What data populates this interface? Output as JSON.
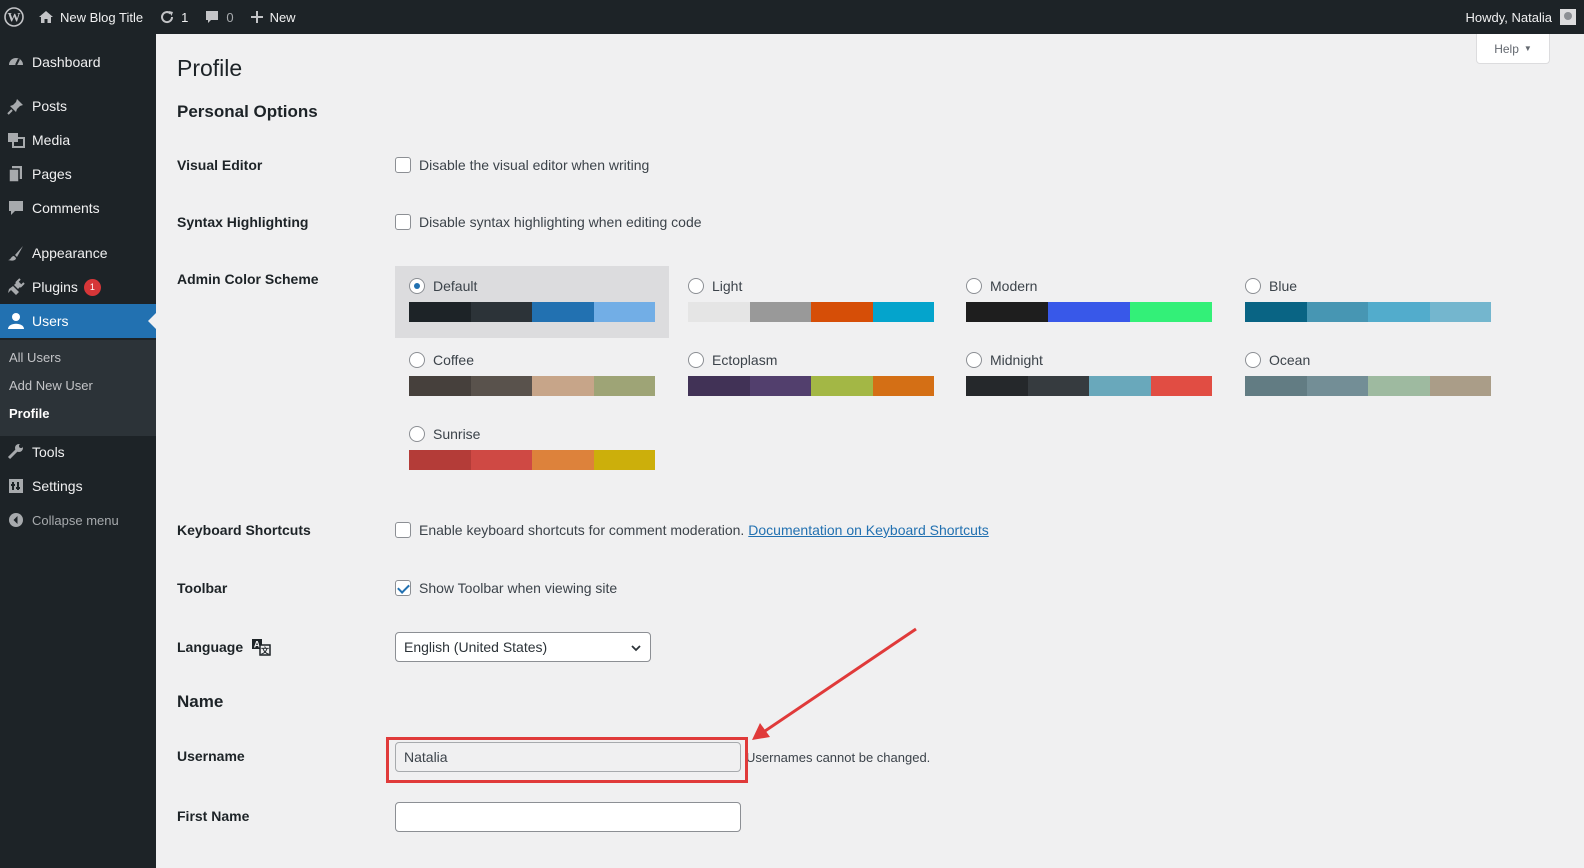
{
  "admin_bar": {
    "site_title": "New Blog Title",
    "updates_count": "1",
    "comments_count": "0",
    "new_label": "New",
    "greeting": "Howdy, Natalia"
  },
  "sidebar": {
    "items": [
      {
        "label": "Dashboard",
        "icon": "dashboard-icon"
      },
      {
        "label": "Posts",
        "icon": "pin-icon"
      },
      {
        "label": "Media",
        "icon": "media-icon"
      },
      {
        "label": "Pages",
        "icon": "pages-icon"
      },
      {
        "label": "Comments",
        "icon": "comment-icon"
      },
      {
        "label": "Appearance",
        "icon": "brush-icon"
      },
      {
        "label": "Plugins",
        "icon": "plugin-icon",
        "badge": "1"
      },
      {
        "label": "Users",
        "icon": "user-icon",
        "current": true
      },
      {
        "label": "Tools",
        "icon": "wrench-icon"
      },
      {
        "label": "Settings",
        "icon": "settings-icon"
      }
    ],
    "submenu": [
      "All Users",
      "Add New User",
      "Profile"
    ],
    "collapse_label": "Collapse menu"
  },
  "help_label": "Help",
  "page_title": "Profile",
  "personal_options": {
    "heading": "Personal Options",
    "visual_editor": {
      "label": "Visual Editor",
      "option": "Disable the visual editor when writing",
      "checked": false
    },
    "syntax_highlighting": {
      "label": "Syntax Highlighting",
      "option": "Disable syntax highlighting when editing code",
      "checked": false
    },
    "color_scheme": {
      "label": "Admin Color Scheme",
      "schemes": [
        {
          "name": "Default",
          "selected": true,
          "colors": [
            "#1d2327",
            "#2c3338",
            "#2271b1",
            "#72aee6"
          ]
        },
        {
          "name": "Light",
          "selected": false,
          "colors": [
            "#e5e5e5",
            "#999999",
            "#d64e07",
            "#04a4cc"
          ]
        },
        {
          "name": "Modern",
          "selected": false,
          "colors": [
            "#1e1e1e",
            "#3858e9",
            "#33f078"
          ]
        },
        {
          "name": "Blue",
          "selected": false,
          "colors": [
            "#096484",
            "#4796b3",
            "#52accc",
            "#74b6ce"
          ]
        },
        {
          "name": "Coffee",
          "selected": false,
          "colors": [
            "#46403c",
            "#59524c",
            "#c7a589",
            "#9ea476"
          ]
        },
        {
          "name": "Ectoplasm",
          "selected": false,
          "colors": [
            "#413256",
            "#523f6d",
            "#a3b745",
            "#d46f15"
          ]
        },
        {
          "name": "Midnight",
          "selected": false,
          "colors": [
            "#25282b",
            "#363b3f",
            "#69a8bb",
            "#e14d43"
          ]
        },
        {
          "name": "Ocean",
          "selected": false,
          "colors": [
            "#627c83",
            "#738e96",
            "#9ebaa0",
            "#aa9d88"
          ]
        },
        {
          "name": "Sunrise",
          "selected": false,
          "colors": [
            "#b43c38",
            "#cf4944",
            "#dd823b",
            "#ccaf0b"
          ]
        }
      ]
    },
    "keyboard_shortcuts": {
      "label": "Keyboard Shortcuts",
      "option": "Enable keyboard shortcuts for comment moderation.",
      "link": "Documentation on Keyboard Shortcuts",
      "checked": false
    },
    "toolbar": {
      "label": "Toolbar",
      "option": "Show Toolbar when viewing site",
      "checked": true
    },
    "language": {
      "label": "Language",
      "value": "English (United States)"
    }
  },
  "name_section": {
    "heading": "Name",
    "username": {
      "label": "Username",
      "value": "Natalia",
      "description": "Usernames cannot be changed."
    },
    "first_name": {
      "label": "First Name",
      "value": ""
    }
  },
  "annotation": {
    "color": "#e03a3a"
  }
}
